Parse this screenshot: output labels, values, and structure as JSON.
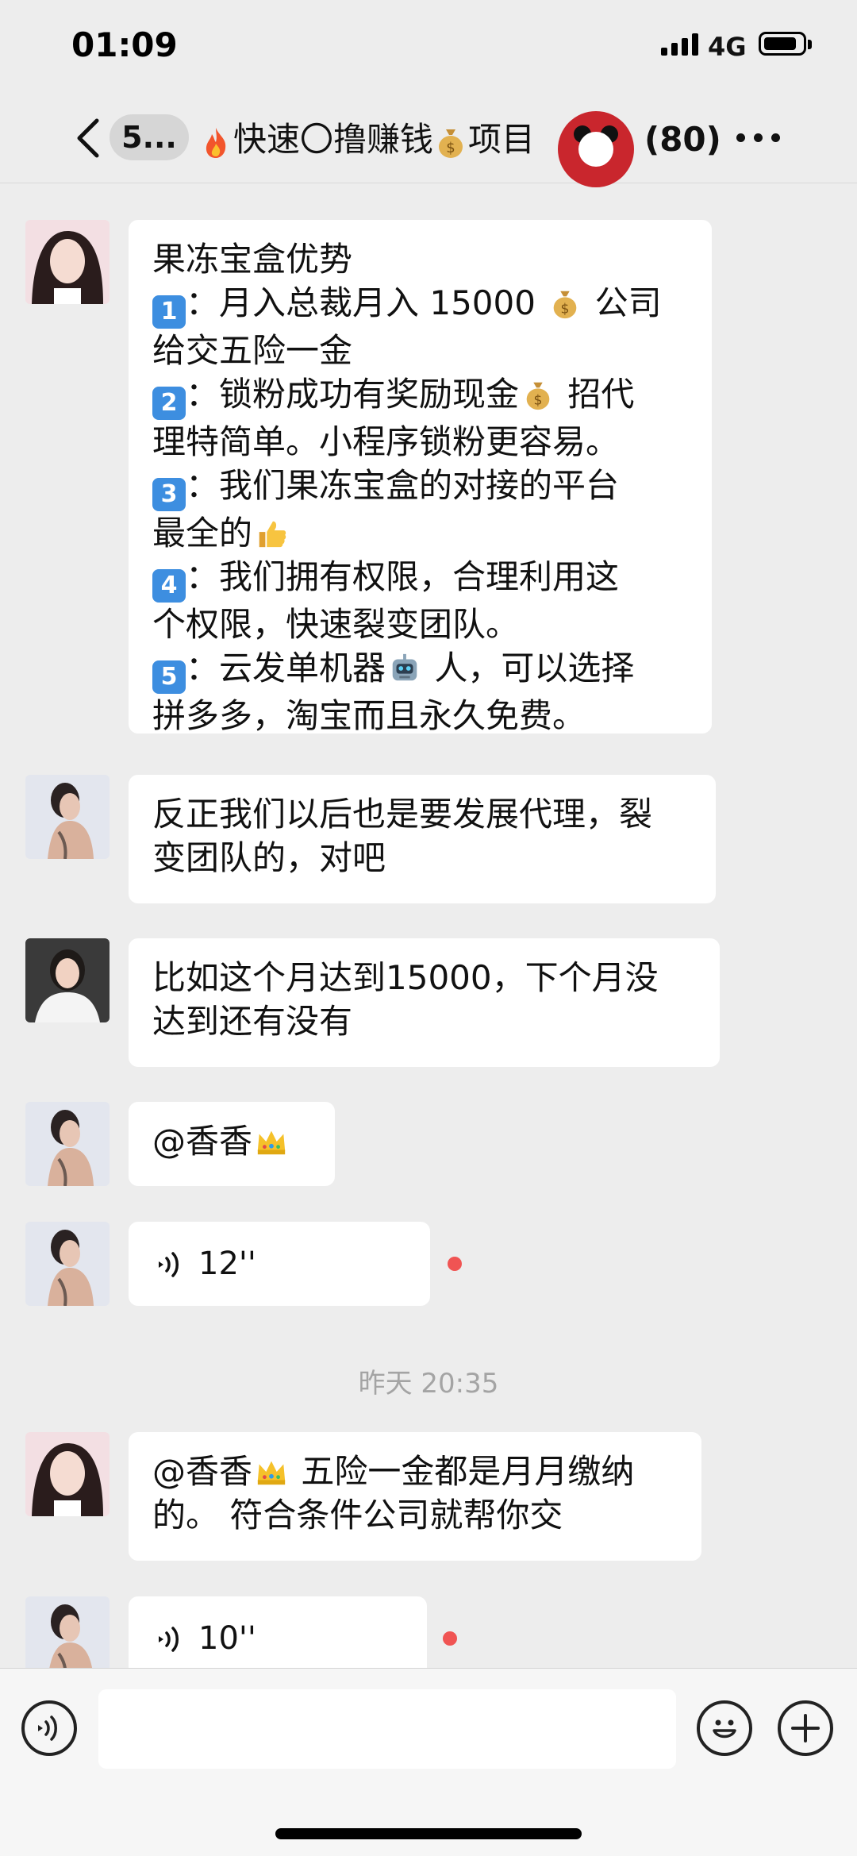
{
  "status_bar": {
    "time": "01:09",
    "network": "4G"
  },
  "nav": {
    "back_badge": "5...",
    "title": "快速〇撸赚钱",
    "title_suffix": "项目",
    "member_count": "(80)"
  },
  "messages": [
    {
      "lines": [
        {
          "text": "果冻宝盒优势"
        },
        {
          "num": "1",
          "pre": "：月入总裁月入 15000 ",
          "emoji": "money-bag-icon",
          "post": " 公司"
        },
        {
          "text": "给交五险一金"
        },
        {
          "num": "2",
          "pre": "：锁粉成功有奖励现金",
          "emoji": "money-bag-icon",
          "post": " 招代"
        },
        {
          "text": "理特简单。小程序锁粉更容易。"
        },
        {
          "num": "3",
          "pre": "：我们果冻宝盒的对接的平台"
        },
        {
          "text": "最全的",
          "emoji": "thumbs-up-icon"
        },
        {
          "num": "4",
          "pre": "：我们拥有权限，合理利用这"
        },
        {
          "text": "个权限，快速裂变团队。"
        },
        {
          "num": "5",
          "pre": "：云发单机器",
          "emoji": "robot-icon",
          "post": " 人，可以选择"
        },
        {
          "text": "拼多多，淘宝而且永久免费。"
        }
      ]
    },
    {
      "text": "反正我们以后也是要发展代理，裂\n变团队的，对吧"
    },
    {
      "text": "比如这个月达到15000，下个月没\n达到还有没有"
    },
    {
      "text": "@香香",
      "emoji": "crown-icon"
    },
    {
      "voice": "12''"
    },
    {
      "time_divider": "昨天 20:35"
    },
    {
      "text": "@香香",
      "emoji": "crown-icon",
      "post": " 五险一金都是月月缴纳\n的。 符合条件公司就帮你交"
    },
    {
      "voice": "10''"
    }
  ],
  "input": {
    "placeholder": ""
  },
  "icons": [
    "chevron-left-icon",
    "fire-icon",
    "money-bag-icon",
    "thumbs-up-icon",
    "robot-icon",
    "crown-icon",
    "voice-wave-icon",
    "emoji-face-icon",
    "plus-icon",
    "more-icon"
  ],
  "colors": {
    "background": "#ededed",
    "bubble": "#ffffff",
    "unread_dot": "#f05453",
    "keycap": "#3d8ee0"
  }
}
